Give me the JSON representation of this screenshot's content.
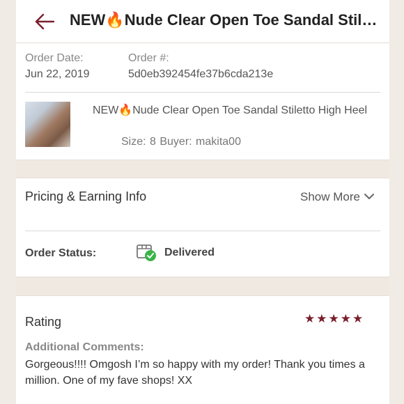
{
  "header": {
    "title": "NEW🔥Nude Clear Open Toe Sandal Stiletto High Heel"
  },
  "order": {
    "date_label": "Order Date:",
    "date_value": "Jun 22, 2019",
    "number_label": "Order #:",
    "number_value": "5d0eb392454fe37b6cda213e"
  },
  "item": {
    "title": "NEW🔥Nude Clear Open Toe Sandal Stiletto High Heel",
    "meta": "Size: 8  Buyer: makita00"
  },
  "pricing": {
    "title": "Pricing & Earning Info",
    "show_more": "Show More"
  },
  "status": {
    "label": "Order Status:",
    "value": "Delivered"
  },
  "rating": {
    "title": "Rating",
    "stars": 5,
    "stars_text": "★★★★★",
    "comments_label": "Additional Comments:",
    "comments": "Gorgeous!!!! Omgosh I’m so happy with my order! Thank you times a million. One of my fave shops! XX"
  },
  "colors": {
    "accent": "#7a1e2c",
    "band": "#efe9e2",
    "success": "#3ab449"
  },
  "icons": {
    "back": "arrow-left-icon",
    "chevron": "chevron-down-icon",
    "status": "package-delivered-icon",
    "star": "star-icon"
  }
}
